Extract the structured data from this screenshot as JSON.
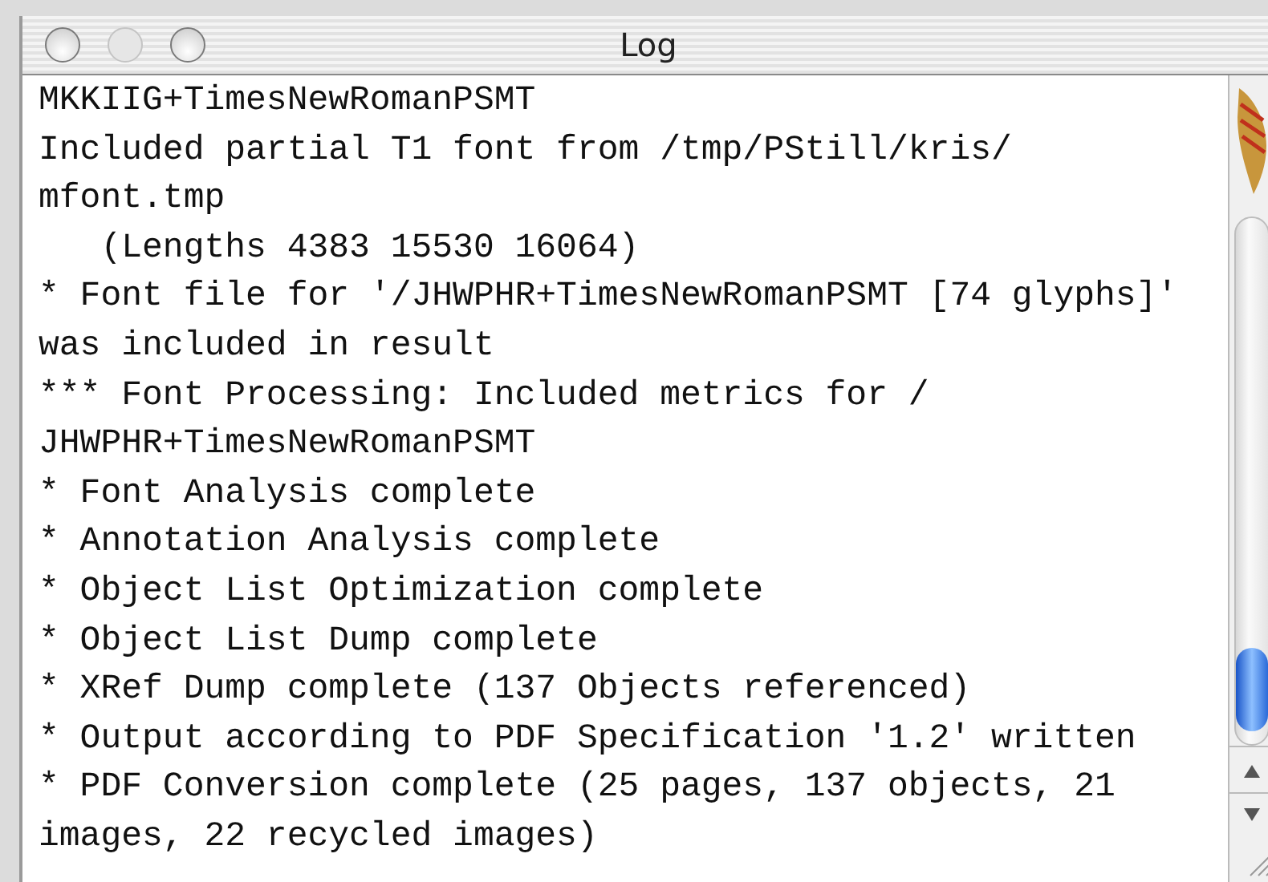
{
  "window": {
    "title": "Log"
  },
  "log": {
    "lines": [
      "MKKIIG+TimesNewRomanPSMT",
      "Included partial T1 font from /tmp/PStill/kris/",
      "mfont.tmp",
      "   (Lengths 4383 15530 16064)",
      "* Font file for '/JHWPHR+TimesNewRomanPSMT [74 glyphs]'",
      "was included in result",
      "*** Font Processing: Included metrics for /",
      "JHWPHR+TimesNewRomanPSMT",
      "* Font Analysis complete",
      "* Annotation Analysis complete",
      "* Object List Optimization complete",
      "* Object List Dump complete",
      "* XRef Dump complete (137 Objects referenced)",
      "* Output according to PDF Specification '1.2' written",
      "* PDF Conversion complete (25 pages, 137 objects, 21",
      "images, 22 recycled images)"
    ]
  }
}
